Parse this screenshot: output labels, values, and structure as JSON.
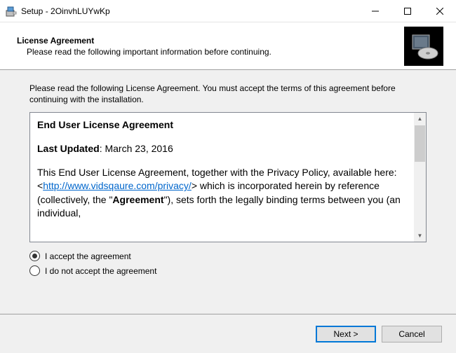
{
  "titlebar": {
    "text": "Setup - 2OinvhLUYwKp"
  },
  "header": {
    "title": "License Agreement",
    "subtitle": "Please read the following important information before continuing."
  },
  "instruction": "Please read the following License Agreement. You must accept the terms of this agreement before continuing with the installation.",
  "eula": {
    "heading": "End User License Agreement",
    "updated_label": "Last Updated",
    "updated_value": ": March 23, 2016",
    "body_pre": "This End User License Agreement, together with the Privacy Policy, available here: <",
    "link": "http://www.vidsqaure.com/privacy/",
    "body_post1": "> which is incorporated herein by reference (collectively, the \"",
    "body_bold": "Agreement",
    "body_post2": "\"), sets forth the legally binding terms between you (an individual,"
  },
  "radios": {
    "accept": "I accept the agreement",
    "decline": "I do not accept the agreement"
  },
  "footer": {
    "next": "Next >",
    "cancel": "Cancel"
  }
}
